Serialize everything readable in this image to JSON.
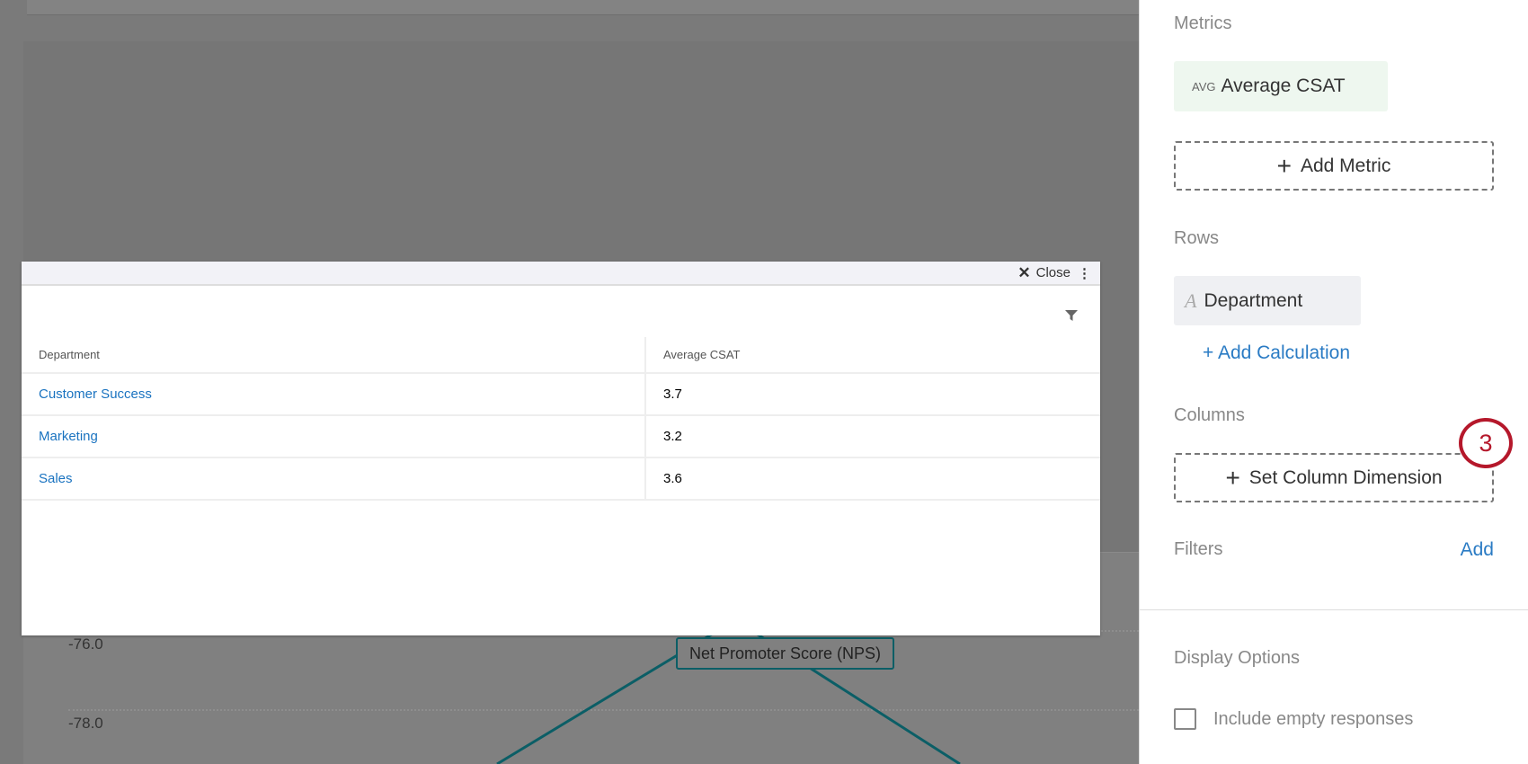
{
  "chart": {
    "y_ticks": [
      "-76.0",
      "-78.0"
    ],
    "series_label": "Net Promoter Score (NPS)",
    "line_color": "#0b5e66"
  },
  "modal": {
    "close_label": "Close",
    "columns": [
      "Department",
      "Average CSAT"
    ],
    "rows": [
      {
        "department": "Customer Success",
        "value": "3.7"
      },
      {
        "department": "Marketing",
        "value": "3.2"
      },
      {
        "department": "Sales",
        "value": "3.6"
      }
    ]
  },
  "sidebar": {
    "metrics_label": "Metrics",
    "metric_prefix": "AVG",
    "metric_name": "Average CSAT",
    "add_metric": "Add Metric",
    "rows_label": "Rows",
    "row_name": "Department",
    "row_icon": "A",
    "add_calculation": "+ Add Calculation",
    "columns_label": "Columns",
    "set_column": "Set Column Dimension",
    "step_badge": "3",
    "filters_label": "Filters",
    "filters_add": "Add",
    "display_options": "Display Options",
    "include_empty": "Include empty responses"
  }
}
